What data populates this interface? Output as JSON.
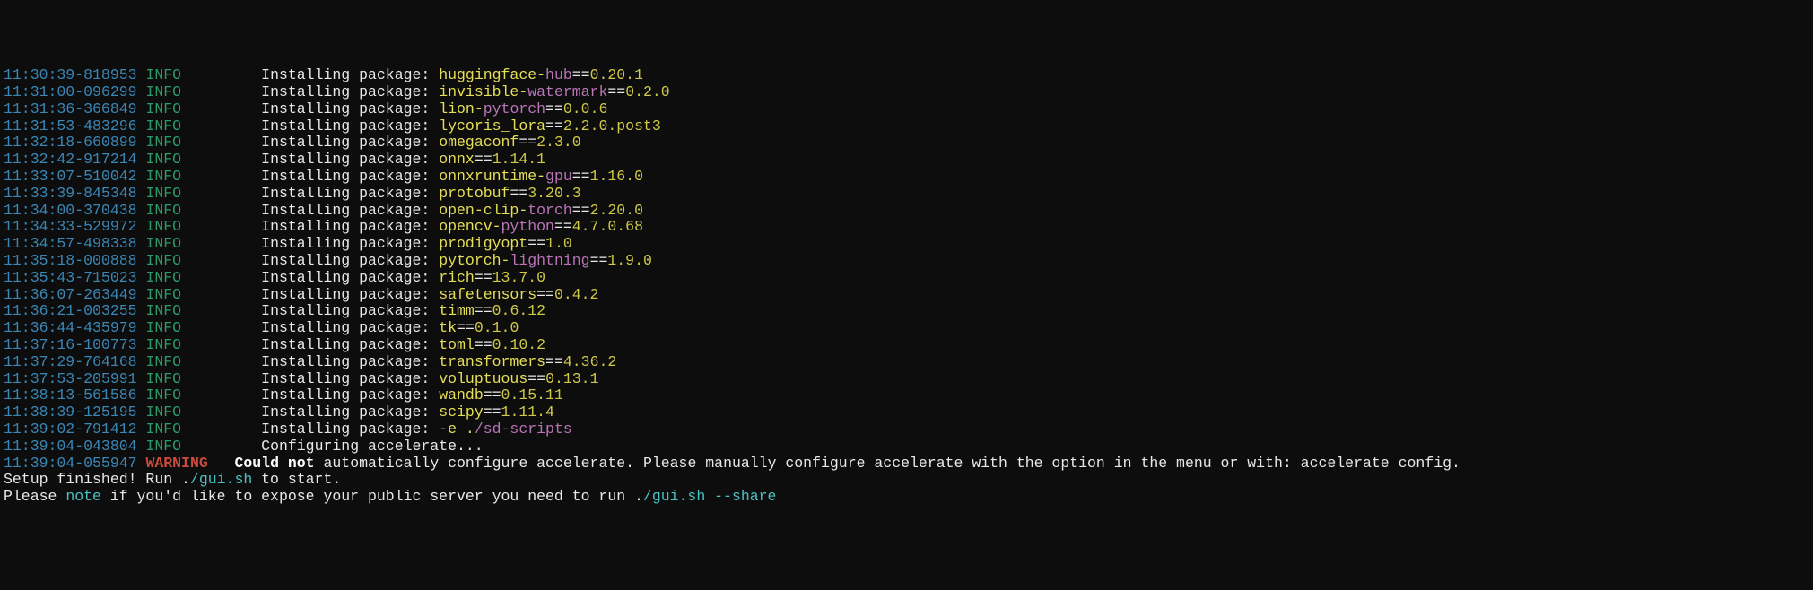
{
  "lines": [
    {
      "ts": "11:30:39-818953",
      "level": "INFO",
      "indent": "     ",
      "prefix": "Installing package: ",
      "pkg_y": "huggingface-",
      "pkg_m": "hub",
      "eq": "==",
      "ver": "0.20.1"
    },
    {
      "ts": "11:31:00-096299",
      "level": "INFO",
      "indent": "     ",
      "prefix": "Installing package: ",
      "pkg_y": "invisible-",
      "pkg_m": "watermark",
      "eq": "==",
      "ver": "0.2.0"
    },
    {
      "ts": "11:31:36-366849",
      "level": "INFO",
      "indent": "     ",
      "prefix": "Installing package: ",
      "pkg_y": "lion-",
      "pkg_m": "pytorch",
      "eq": "==",
      "ver": "0.0.6"
    },
    {
      "ts": "11:31:53-483296",
      "level": "INFO",
      "indent": "     ",
      "prefix": "Installing package: ",
      "pkg_y": "lycoris_lora",
      "pkg_m": "",
      "eq": "==",
      "ver": "2.2.0.post3"
    },
    {
      "ts": "11:32:18-660899",
      "level": "INFO",
      "indent": "     ",
      "prefix": "Installing package: ",
      "pkg_y": "omegaconf",
      "pkg_m": "",
      "eq": "==",
      "ver": "2.3.0"
    },
    {
      "ts": "11:32:42-917214",
      "level": "INFO",
      "indent": "     ",
      "prefix": "Installing package: ",
      "pkg_y": "onnx",
      "pkg_m": "",
      "eq": "==",
      "ver": "1.14.1"
    },
    {
      "ts": "11:33:07-510042",
      "level": "INFO",
      "indent": "     ",
      "prefix": "Installing package: ",
      "pkg_y": "onnxruntime-",
      "pkg_m": "gpu",
      "eq": "==",
      "ver": "1.16.0"
    },
    {
      "ts": "11:33:39-845348",
      "level": "INFO",
      "indent": "     ",
      "prefix": "Installing package: ",
      "pkg_y": "protobuf",
      "pkg_m": "",
      "eq": "==",
      "ver": "3.20.3"
    },
    {
      "ts": "11:34:00-370438",
      "level": "INFO",
      "indent": "     ",
      "prefix": "Installing package: ",
      "pkg_y": "open-clip-",
      "pkg_m": "torch",
      "eq": "==",
      "ver": "2.20.0"
    },
    {
      "ts": "11:34:33-529972",
      "level": "INFO",
      "indent": "     ",
      "prefix": "Installing package: ",
      "pkg_y": "opencv-",
      "pkg_m": "python",
      "eq": "==",
      "ver": "4.7.0.68"
    },
    {
      "ts": "11:34:57-498338",
      "level": "INFO",
      "indent": "     ",
      "prefix": "Installing package: ",
      "pkg_y": "prodigyopt",
      "pkg_m": "",
      "eq": "==",
      "ver": "1.0"
    },
    {
      "ts": "11:35:18-000888",
      "level": "INFO",
      "indent": "     ",
      "prefix": "Installing package: ",
      "pkg_y": "pytorch-",
      "pkg_m": "lightning",
      "eq": "==",
      "ver": "1.9.0"
    },
    {
      "ts": "11:35:43-715023",
      "level": "INFO",
      "indent": "     ",
      "prefix": "Installing package: ",
      "pkg_y": "rich",
      "pkg_m": "",
      "eq": "==",
      "ver": "13.7.0"
    },
    {
      "ts": "11:36:07-263449",
      "level": "INFO",
      "indent": "     ",
      "prefix": "Installing package: ",
      "pkg_y": "safetensors",
      "pkg_m": "",
      "eq": "==",
      "ver": "0.4.2"
    },
    {
      "ts": "11:36:21-003255",
      "level": "INFO",
      "indent": "     ",
      "prefix": "Installing package: ",
      "pkg_y": "timm",
      "pkg_m": "",
      "eq": "==",
      "ver": "0.6.12"
    },
    {
      "ts": "11:36:44-435979",
      "level": "INFO",
      "indent": "     ",
      "prefix": "Installing package: ",
      "pkg_y": "tk",
      "pkg_m": "",
      "eq": "==",
      "ver": "0.1.0"
    },
    {
      "ts": "11:37:16-100773",
      "level": "INFO",
      "indent": "     ",
      "prefix": "Installing package: ",
      "pkg_y": "toml",
      "pkg_m": "",
      "eq": "==",
      "ver": "0.10.2"
    },
    {
      "ts": "11:37:29-764168",
      "level": "INFO",
      "indent": "     ",
      "prefix": "Installing package: ",
      "pkg_y": "transformers",
      "pkg_m": "",
      "eq": "==",
      "ver": "4.36.2"
    },
    {
      "ts": "11:37:53-205991",
      "level": "INFO",
      "indent": "     ",
      "prefix": "Installing package: ",
      "pkg_y": "voluptuous",
      "pkg_m": "",
      "eq": "==",
      "ver": "0.13.1"
    },
    {
      "ts": "11:38:13-561586",
      "level": "INFO",
      "indent": "     ",
      "prefix": "Installing package: ",
      "pkg_y": "wandb",
      "pkg_m": "",
      "eq": "==",
      "ver": "0.15.11"
    },
    {
      "ts": "11:38:39-125195",
      "level": "INFO",
      "indent": "     ",
      "prefix": "Installing package: ",
      "pkg_y": "scipy",
      "pkg_m": "",
      "eq": "==",
      "ver": "1.11.4"
    },
    {
      "ts": "11:39:02-791412",
      "level": "INFO",
      "indent": "     ",
      "prefix": "Installing package: ",
      "pkg_y": "-e .",
      "pkg_m": "/sd-scripts",
      "eq": "",
      "ver": ""
    },
    {
      "ts": "11:39:04-043804",
      "level": "INFO",
      "indent": "     ",
      "prefix": "Configuring accelerate...",
      "pkg_y": "",
      "pkg_m": "",
      "eq": "",
      "ver": ""
    }
  ],
  "warning_line": {
    "ts": "11:39:04-055947",
    "level": "WARNING",
    "indent": "  ",
    "bold": "Could not",
    "rest": " automatically configure accelerate. Please manually configure accelerate with the option in the menu or with: accelerate config."
  },
  "footer1": {
    "pre": "Setup finished! Run .",
    "cyan": "/gui.sh",
    "post": " to start."
  },
  "footer2": {
    "pre": "Please ",
    "cyan1": "note",
    "mid": " if you'd like to expose your public server you need to run .",
    "cyan2": "/gui.sh",
    "post": " ",
    "cyan3": "--share"
  },
  "level_pad": {
    "INFO": "INFO    ",
    "WARNING": "WARNING "
  }
}
